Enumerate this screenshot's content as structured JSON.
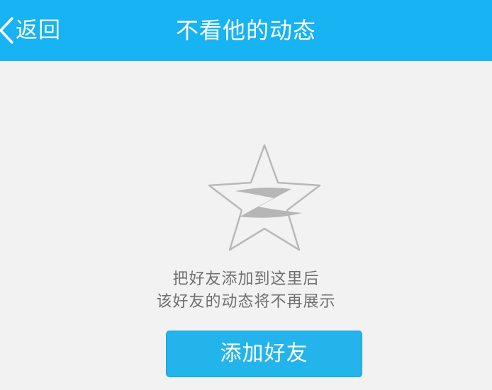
{
  "header": {
    "back_label": "返回",
    "title": "不看他的动态"
  },
  "empty_state": {
    "icon": "qzone-star-icon",
    "line1": "把好友添加到这里后",
    "line2": "该好友的动态将不再展示"
  },
  "actions": {
    "add_friend_label": "添加好友"
  },
  "colors": {
    "header_bg": "#17b3f2",
    "page_bg": "#f2f2f2",
    "button_bg": "#24b4ec",
    "text_gray": "#707070"
  }
}
